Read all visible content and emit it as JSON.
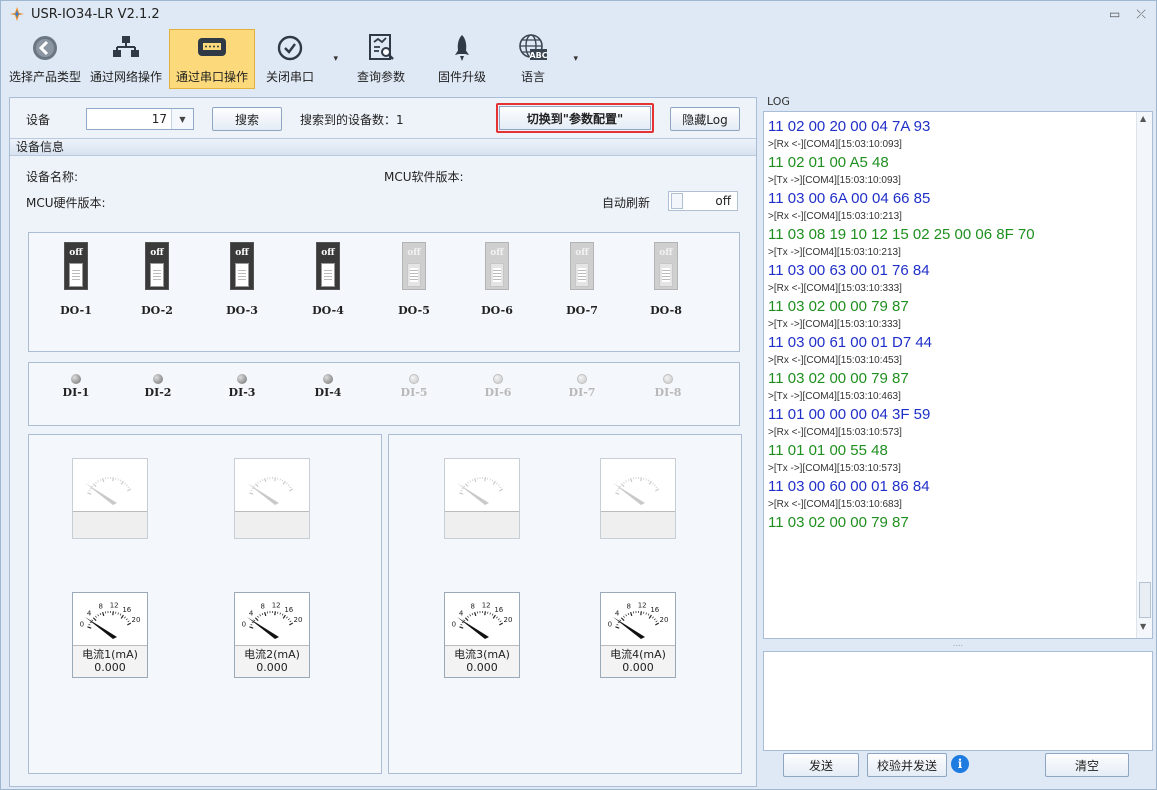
{
  "window": {
    "title": "USR-IO34-LR V2.1.2",
    "minimize": "▭",
    "close": "⤫"
  },
  "toolbar": {
    "items": [
      {
        "label": "选择产品类型",
        "icon": "back-circle-icon"
      },
      {
        "label": "通过网络操作",
        "icon": "network-icon"
      },
      {
        "label": "通过串口操作",
        "icon": "serial-port-icon",
        "active": true
      },
      {
        "label": "关闭串口",
        "icon": "check-circle-icon"
      },
      {
        "label": "查询参数",
        "icon": "query-params-icon"
      },
      {
        "label": "固件升级",
        "icon": "rocket-icon"
      },
      {
        "label": "语言",
        "icon": "globe-abc-icon"
      }
    ],
    "dropdown_glyph": "▾"
  },
  "device": {
    "label": "设备",
    "value": "17",
    "search_button": "搜索",
    "found_label": "搜索到的设备数：1",
    "switch_button": "切换到\"参数配置\"",
    "hide_log_button": "隐藏Log"
  },
  "info": {
    "section_title": "设备信息",
    "device_name_label": "设备名称:",
    "mcu_sw_label": "MCU软件版本:",
    "mcu_hw_label": "MCU硬件版本:",
    "auto_refresh_label": "自动刷新",
    "auto_refresh_state": "off"
  },
  "outputs": [
    {
      "name": "DO-1",
      "state": "off",
      "enabled": true
    },
    {
      "name": "DO-2",
      "state": "off",
      "enabled": true
    },
    {
      "name": "DO-3",
      "state": "off",
      "enabled": true
    },
    {
      "name": "DO-4",
      "state": "off",
      "enabled": true
    },
    {
      "name": "DO-5",
      "state": "off",
      "enabled": false
    },
    {
      "name": "DO-6",
      "state": "off",
      "enabled": false
    },
    {
      "name": "DO-7",
      "state": "off",
      "enabled": false
    },
    {
      "name": "DO-8",
      "state": "off",
      "enabled": false
    }
  ],
  "inputs": [
    {
      "name": "DI-1",
      "enabled": true
    },
    {
      "name": "DI-2",
      "enabled": true
    },
    {
      "name": "DI-3",
      "enabled": true
    },
    {
      "name": "DI-4",
      "enabled": true
    },
    {
      "name": "DI-5",
      "enabled": false
    },
    {
      "name": "DI-6",
      "enabled": false
    },
    {
      "name": "DI-7",
      "enabled": false
    },
    {
      "name": "DI-8",
      "enabled": false
    }
  ],
  "current_meters": [
    {
      "label": "电流1(mA)",
      "value": "0.000"
    },
    {
      "label": "电流2(mA)",
      "value": "0.000"
    },
    {
      "label": "电流3(mA)",
      "value": "0.000"
    },
    {
      "label": "电流4(mA)",
      "value": "0.000"
    }
  ],
  "meter_scale": [
    "0",
    "4",
    "8",
    "12",
    "16",
    "20"
  ],
  "log": {
    "title": "LOG",
    "entries": [
      {
        "text": "11 02 00 20 00 04 7A 93",
        "kind": "tx"
      },
      {
        "text": ">[Rx <-][COM4][15:03:10:093]",
        "kind": "meta"
      },
      {
        "text": "11 02 01 00 A5 48",
        "kind": "rx"
      },
      {
        "text": ">[Tx ->][COM4][15:03:10:093]",
        "kind": "meta"
      },
      {
        "text": "11 03 00 6A 00 04 66 85",
        "kind": "tx"
      },
      {
        "text": ">[Rx <-][COM4][15:03:10:213]",
        "kind": "meta"
      },
      {
        "text": "11 03 08 19 10 12 15 02 25 00 06 8F 70",
        "kind": "rx"
      },
      {
        "text": ">[Tx ->][COM4][15:03:10:213]",
        "kind": "meta"
      },
      {
        "text": "11 03 00 63 00 01 76 84",
        "kind": "tx"
      },
      {
        "text": ">[Rx <-][COM4][15:03:10:333]",
        "kind": "meta"
      },
      {
        "text": "11 03 02 00 00 79 87",
        "kind": "rx"
      },
      {
        "text": ">[Tx ->][COM4][15:03:10:333]",
        "kind": "meta"
      },
      {
        "text": "11 03 00 61 00 01 D7 44",
        "kind": "tx"
      },
      {
        "text": ">[Rx <-][COM4][15:03:10:453]",
        "kind": "meta"
      },
      {
        "text": "11 03 02 00 00 79 87",
        "kind": "rx"
      },
      {
        "text": ">[Tx ->][COM4][15:03:10:463]",
        "kind": "meta"
      },
      {
        "text": "11 01 00 00 00 04 3F 59",
        "kind": "tx"
      },
      {
        "text": ">[Rx <-][COM4][15:03:10:573]",
        "kind": "meta"
      },
      {
        "text": "11 01 01 00 55 48",
        "kind": "rx"
      },
      {
        "text": ">[Tx ->][COM4][15:03:10:573]",
        "kind": "meta"
      },
      {
        "text": "11 03 00 60 00 01 86 84",
        "kind": "tx"
      },
      {
        "text": ">[Rx <-][COM4][15:03:10:683]",
        "kind": "meta"
      },
      {
        "text": "11 03 02 00 00 79 87",
        "kind": "rx"
      }
    ],
    "send_button": "发送",
    "checksum_send_button": "校验并发送",
    "clear_button": "清空",
    "splitter": "....",
    "tx_color": "#1f2fc8",
    "rx_color": "#1f8f1f"
  }
}
